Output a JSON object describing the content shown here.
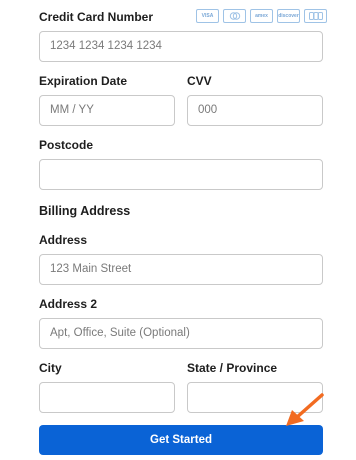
{
  "payment_form": {
    "card_number": {
      "label": "Credit Card Number",
      "placeholder": "1234 1234 1234 1234"
    },
    "card_brands": [
      "VISA",
      "mastercard",
      "amex",
      "discover",
      "jcb"
    ],
    "expiration": {
      "label": "Expiration Date",
      "placeholder": "MM / YY"
    },
    "cvv": {
      "label": "CVV",
      "placeholder": "000"
    },
    "postcode": {
      "label": "Postcode",
      "placeholder": ""
    }
  },
  "billing_address": {
    "heading": "Billing Address",
    "address": {
      "label": "Address",
      "placeholder": "123 Main Street"
    },
    "address2": {
      "label": "Address 2",
      "placeholder": "Apt, Office, Suite (Optional)"
    },
    "city": {
      "label": "City",
      "placeholder": ""
    },
    "state": {
      "label": "State / Province",
      "placeholder": ""
    }
  },
  "submit": {
    "label": "Get Started",
    "color": "#0a63d6"
  },
  "annotation": {
    "arrow_color": "#f26b21"
  }
}
